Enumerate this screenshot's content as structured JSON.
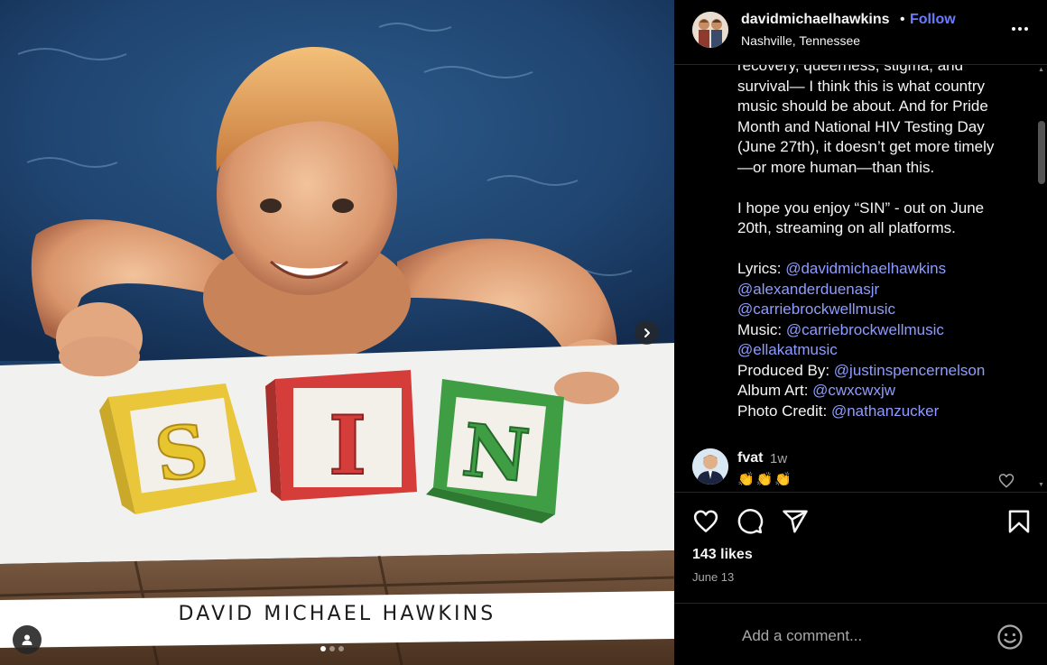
{
  "post": {
    "image": {
      "album_artist_text": "DAVID MICHAEL HAWKINS",
      "blocks": [
        "S",
        "I",
        "N"
      ],
      "carousel_total": 3,
      "carousel_active": 1
    },
    "header": {
      "username": "davidmichaelhawkins",
      "bullet": "•",
      "follow_label": "Follow",
      "location": "Nashville, Tennessee"
    },
    "caption": {
      "lines_part1": [
        "recovery, queerness, stigma, and",
        "survival— I think this is what country",
        "music should be about. And for Pride",
        "Month and National HIV Testing Day",
        "(June 27th), it doesn’t get more timely",
        "—or more human—than this."
      ],
      "para2": "I hope you enjoy “SIN” - out on June 20th, streaming on all platforms.",
      "credits": {
        "lyrics_label": "Lyrics: ",
        "lyrics_mentions": [
          "@davidmichaelhawkins",
          "@alexanderduenasjr",
          "@carriebrockwellmusic"
        ],
        "music_label": "Music: ",
        "music_mentions": [
          "@carriebrockwellmusic",
          "@ellakatmusic"
        ],
        "produced_label": "Produced By: ",
        "produced_mention": "@justinspencernelson",
        "album_art_label": "Album Art: ",
        "album_art_mention": "@cwxcwxjw",
        "photo_label": "Photo Credit: ",
        "photo_mention": "@nathanzucker"
      }
    },
    "comment": {
      "username": "fvat",
      "time": "1w",
      "text": "👏👏👏"
    },
    "likes": "143 likes",
    "date": "June 13",
    "add_comment_placeholder": "Add a comment...",
    "icons": {
      "like": "heart-icon",
      "comment": "comment-icon",
      "share": "share-icon",
      "save": "bookmark-icon",
      "more": "more-icon",
      "emoji": "emoji-icon",
      "next": "chevron-right-icon",
      "user_tags": "user-icon"
    },
    "colors": {
      "accent_link": "#8e9cff",
      "follow": "#6b7cff",
      "background": "#000000",
      "muted": "#a8a8a8"
    }
  }
}
